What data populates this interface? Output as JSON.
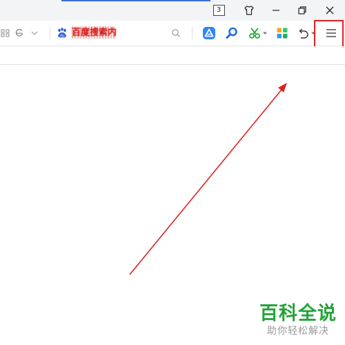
{
  "titlebar": {
    "tab_count": "3",
    "icons": {
      "tab_count": "tab-count-icon",
      "skin": "tshirt-icon",
      "minimize": "minimize-icon",
      "restore": "restore-icon",
      "close": "close-icon"
    }
  },
  "toolbar": {
    "search_text": "百度搜索内容",
    "icons": [
      "apps-grid-icon",
      "browser-engine-icon",
      "chevron-down-icon",
      "baidu-paw-icon",
      "search-icon",
      "ai-triangle-icon",
      "find-magnifier-icon",
      "scissors-icon",
      "app-center-icon",
      "undo-icon",
      "menu-icon"
    ]
  },
  "colors": {
    "annotation_red": "#e02020",
    "watermark_green": "#24a33a",
    "accent_blue": "#3b6fd4"
  },
  "watermark": {
    "main": "百科全说",
    "sub": "助你轻松解决"
  }
}
